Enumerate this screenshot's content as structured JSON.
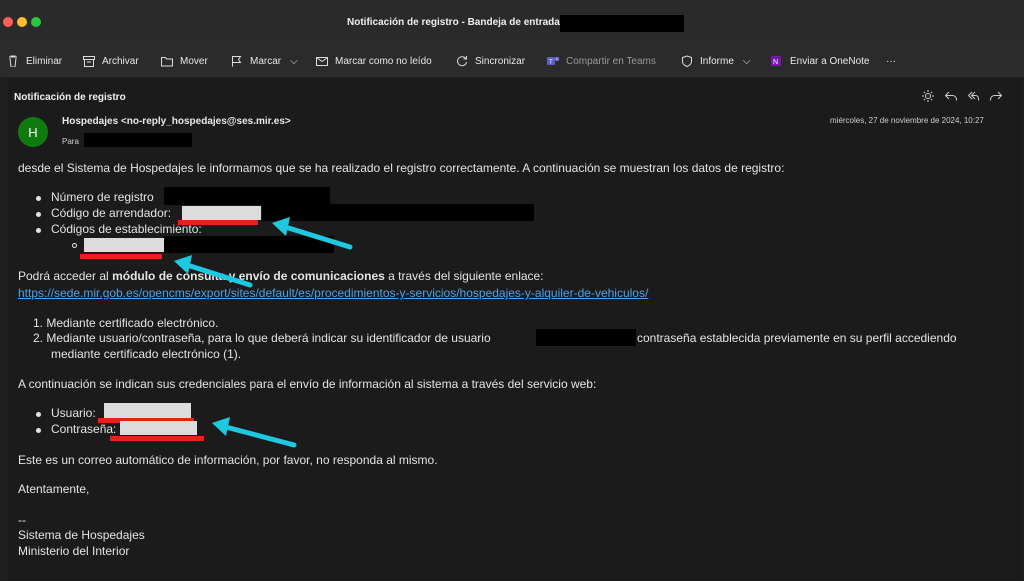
{
  "window": {
    "title": "Notificación de registro - Bandeja de entrada •"
  },
  "toolbar": {
    "eliminar": "Eliminar",
    "archivar": "Archivar",
    "mover": "Mover",
    "marcar": "Marcar",
    "marcar_no_leido": "Marcar como no leído",
    "sincronizar": "Sincronizar",
    "compartir_teams": "Compartir en Teams",
    "informe": "Informe",
    "enviar_onenote": "Enviar a OneNote",
    "more": "···"
  },
  "message": {
    "subject": "Notificación de registro",
    "avatar_letter": "H",
    "sender": "Hospedajes <no-reply_hospedajes@ses.mir.es>",
    "to_label": "Para",
    "date": "miércoles, 27 de noviembre de 2024, 10:27"
  },
  "body": {
    "intro": "desde el Sistema de Hospedajes le informamos que se ha realizado el registro correctamente. A continuación se muestran los datos de registro:",
    "items": [
      "Número de registro",
      "Código de arrendador:",
      "Códigos de establecimiento:"
    ],
    "access_pre": "Podrá acceder al ",
    "access_bold": "módulo de consulta y envío de comunicaciones",
    "access_post": " a través del siguiente enlace:",
    "link": "https://sede.mir.gob.es/opencms/export/sites/default/es/procedimientos-y-servicios/hospedajes-y-alquiler-de-vehiculos/",
    "numbered": [
      "1.  Mediante certificado electrónico.",
      "2.  Mediante usuario/contraseña, para lo que deberá indicar su identificador de usuario",
      "contraseña establecida previamente en su perfil accediendo",
      "mediante certificado electrónico (1)."
    ],
    "credentials_intro": "A continuación se indican sus credenciales para el envío de información al sistema a través del servicio web:",
    "credentials": [
      "Usuario:",
      "Contraseña:"
    ],
    "auto_notice": "Este es un correo automático de información, por favor, no responda al mismo.",
    "closing": "Atentamente,",
    "sig_sep": "--",
    "sig_line1": "Sistema de Hospedajes",
    "sig_line2": "Ministerio del Interior"
  },
  "colors": {
    "annotation_arrow": "#1ec8e0",
    "redaction_underline": "#e2231a",
    "avatar": "#0f7b0f",
    "link": "#4ea1e8"
  }
}
